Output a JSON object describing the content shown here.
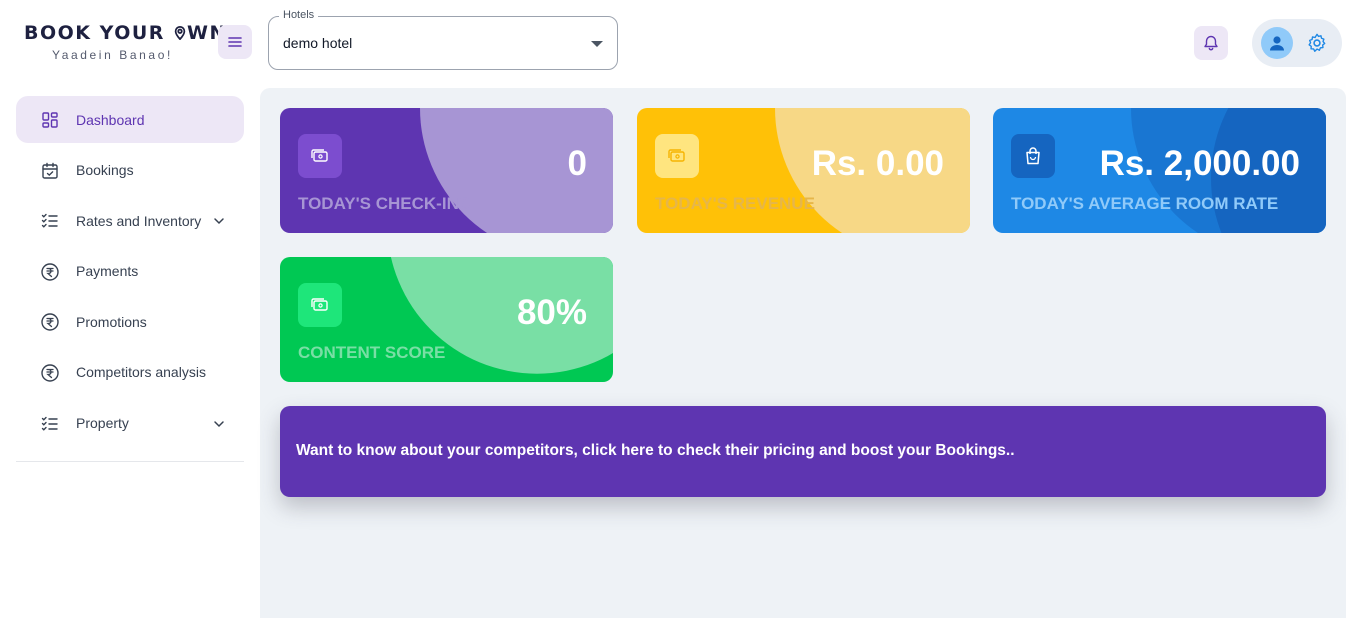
{
  "brand": {
    "name_prefix": "BOOK YOUR ",
    "name_suffix": "WN",
    "tagline": "Yaadein Banao!"
  },
  "hotel_select": {
    "label": "Hotels",
    "value": "demo hotel"
  },
  "colors": {
    "accent": "#5e35b1",
    "accent_light": "#ede7f6",
    "yellow": "#ffc107",
    "blue": "#1e88e5",
    "green": "#00c853"
  },
  "sidebar": {
    "items": [
      {
        "label": "Dashboard",
        "icon": "dashboard-icon",
        "active": true
      },
      {
        "label": "Bookings",
        "icon": "calendar-icon"
      },
      {
        "label": "Rates and Inventory",
        "icon": "checklist-icon",
        "expandable": true
      },
      {
        "label": "Payments",
        "icon": "rupee-icon"
      },
      {
        "label": "Promotions",
        "icon": "rupee-icon"
      },
      {
        "label": "Competitors analysis",
        "icon": "rupee-icon"
      },
      {
        "label": "Property",
        "icon": "checklist-icon",
        "expandable": true
      }
    ]
  },
  "cards": {
    "checkins": {
      "value": "0",
      "label": "TODAY'S CHECK-INS",
      "icon": "cash-icon"
    },
    "revenue": {
      "value": "Rs. 0.00",
      "label": "TODAY'S REVENUE",
      "icon": "cash-icon"
    },
    "avg_rate": {
      "value": "Rs. 2,000.00",
      "label": "TODAY'S AVERAGE ROOM RATE",
      "icon": "shopping-bag-icon"
    },
    "content_score": {
      "value": "80%",
      "label": "CONTENT SCORE",
      "icon": "cash-icon"
    }
  },
  "banner": {
    "text": "Want to know about your competitors, click here to check their pricing and boost your Bookings.."
  }
}
